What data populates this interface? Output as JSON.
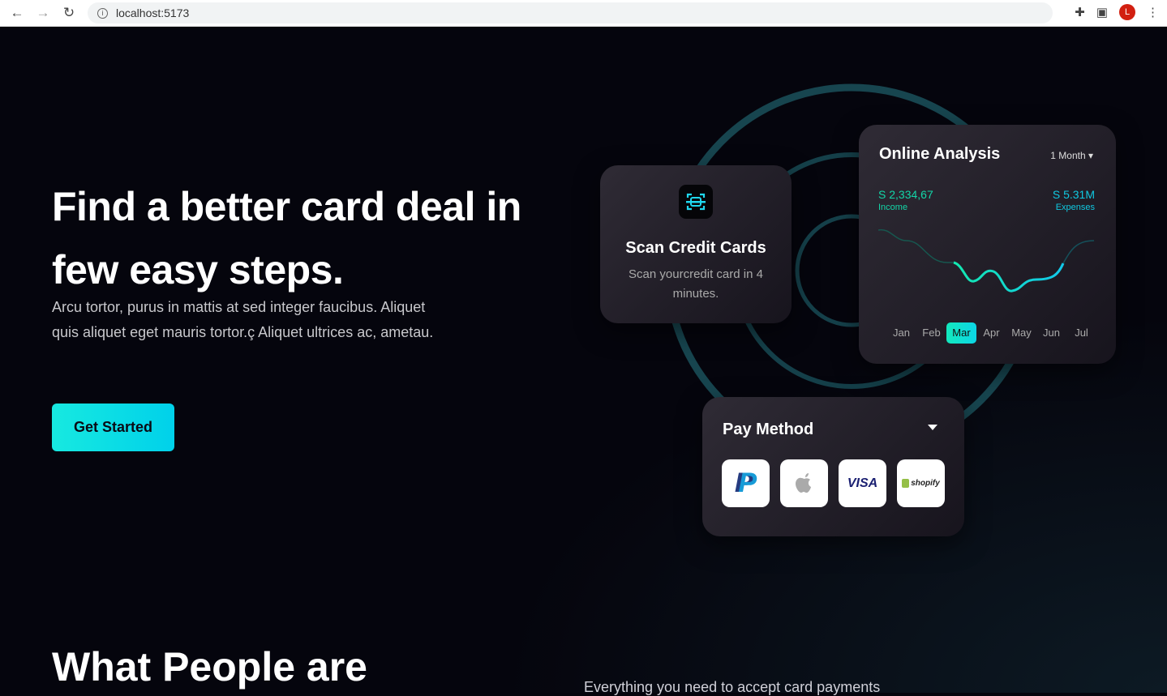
{
  "browser": {
    "url": "localhost:5173",
    "profile_initial": "L"
  },
  "hero": {
    "title": "Find a better card deal in few easy steps.",
    "subtitle": "Arcu tortor, purus in mattis at sed integer faucibus. Aliquet quis aliquet eget mauris tortor.ç Aliquet ultrices ac, ametau.",
    "cta": "Get Started"
  },
  "scan_card": {
    "title": "Scan Credit Cards",
    "desc": "Scan yourcredit card in 4 minutes."
  },
  "analysis": {
    "title": "Online Analysis",
    "period": "1 Month",
    "income_value": "S 2,334,67",
    "income_label": "Income",
    "expenses_value": "S 5.31M",
    "expenses_label": "Expenses",
    "months": [
      "Jan",
      "Feb",
      "Mar",
      "Apr",
      "May",
      "Jun",
      "Jul"
    ],
    "selected_month": "Mar"
  },
  "pay": {
    "title": "Pay Method",
    "methods": [
      "PayPal",
      "Apple",
      "VISA",
      "shopify"
    ]
  },
  "section2": {
    "title": "What People are",
    "tagline": "Everything you need to accept card payments"
  },
  "colors": {
    "accent": "#13e8d8",
    "ring": "#17454f"
  }
}
